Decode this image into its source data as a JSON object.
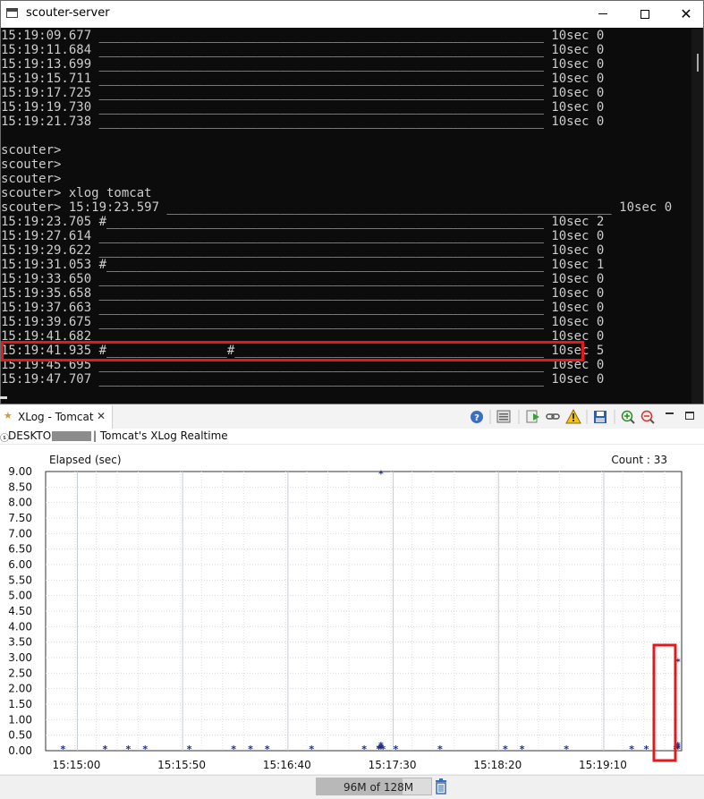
{
  "window": {
    "title": "scouter-server",
    "close_glyph": "✕"
  },
  "console_lines": [
    "15:19:09.677 ___________________________________________________________ 10sec 0",
    "15:19:11.684 ___________________________________________________________ 10sec 0",
    "15:19:13.699 ___________________________________________________________ 10sec 0",
    "15:19:15.711 ___________________________________________________________ 10sec 0",
    "15:19:17.725 ___________________________________________________________ 10sec 0",
    "15:19:19.730 ___________________________________________________________ 10sec 0",
    "15:19:21.738 ___________________________________________________________ 10sec 0",
    "",
    "scouter>",
    "scouter>",
    "scouter>",
    "scouter> xlog tomcat",
    "scouter> 15:19:23.597 ___________________________________________________________ 10sec 0",
    "15:19:23.705 #__________________________________________________________ 10sec 2",
    "15:19:27.614 ___________________________________________________________ 10sec 0",
    "15:19:29.622 ___________________________________________________________ 10sec 0",
    "15:19:31.053 #__________________________________________________________ 10sec 1",
    "15:19:33.650 ___________________________________________________________ 10sec 0",
    "15:19:35.658 ___________________________________________________________ 10sec 0",
    "15:19:37.663 ___________________________________________________________ 10sec 0",
    "15:19:39.675 ___________________________________________________________ 10sec 0",
    "15:19:41.682 ___________________________________________________________ 10sec 0",
    "15:19:41.935 #________________#_________________________________________ 10sec 5",
    "15:19:45.695 ___________________________________________________________ 10sec 0",
    "15:19:47.707 ___________________________________________________________ 10sec 0"
  ],
  "view": {
    "tab_title": "XLog - Tomcat",
    "tab_close": "✕",
    "tab_icon": "★",
    "server_icon": "ⓢ",
    "server_name": "DESKTOP",
    "realtime_label": "| Tomcat's XLog Realtime",
    "toolbar_icons": [
      "help-icon",
      "config-icon",
      "run-icon",
      "link-icon",
      "warning-icon",
      "save-icon",
      "zoom-in-icon",
      "zoom-out-icon"
    ]
  },
  "chart_data": {
    "type": "scatter",
    "ylabel": "Elapsed (sec)",
    "count_label": "Count : 33",
    "ylim": [
      0,
      9
    ],
    "yticks": [
      "9.00",
      "8.50",
      "8.00",
      "7.50",
      "7.00",
      "6.50",
      "6.00",
      "5.50",
      "5.00",
      "4.50",
      "4.00",
      "3.50",
      "3.00",
      "2.50",
      "2.00",
      "1.50",
      "1.00",
      "0.50",
      "0.00"
    ],
    "xticks": [
      "15:15:00",
      "15:15:50",
      "15:16:40",
      "15:17:30",
      "15:18:20",
      "15:19:10"
    ],
    "xtick_seconds": [
      0,
      50,
      100,
      150,
      200,
      250
    ],
    "xlim_seconds": [
      -4,
      298
    ],
    "point_marker": "*",
    "points": [
      [
        0,
        0
      ],
      [
        20,
        0
      ],
      [
        31,
        0
      ],
      [
        39,
        0
      ],
      [
        60,
        0
      ],
      [
        81,
        0
      ],
      [
        89,
        0
      ],
      [
        97,
        0
      ],
      [
        118,
        0
      ],
      [
        143,
        0
      ],
      [
        150,
        0
      ],
      [
        150,
        0.1
      ],
      [
        151,
        0
      ],
      [
        151,
        0.12
      ],
      [
        151,
        0.15
      ],
      [
        151,
        0.2
      ],
      [
        152,
        0.05
      ],
      [
        151,
        8.95
      ],
      [
        158,
        0
      ],
      [
        179,
        0
      ],
      [
        210,
        0
      ],
      [
        218,
        0
      ],
      [
        239,
        0
      ],
      [
        270,
        0
      ],
      [
        277,
        0
      ],
      [
        291,
        0
      ],
      [
        291,
        0
      ],
      [
        291,
        0.05
      ],
      [
        292,
        0
      ],
      [
        292,
        0.1
      ],
      [
        292,
        0.15
      ],
      [
        292,
        0.2
      ],
      [
        292,
        2.9
      ]
    ]
  },
  "status": {
    "heap_label": "96M of 128M",
    "heap_fraction": 0.75
  },
  "colors": {
    "highlight": "#e3191c",
    "point": "#1f2f86",
    "console_bg": "#0c0c0c",
    "console_fg": "#cccccc"
  }
}
